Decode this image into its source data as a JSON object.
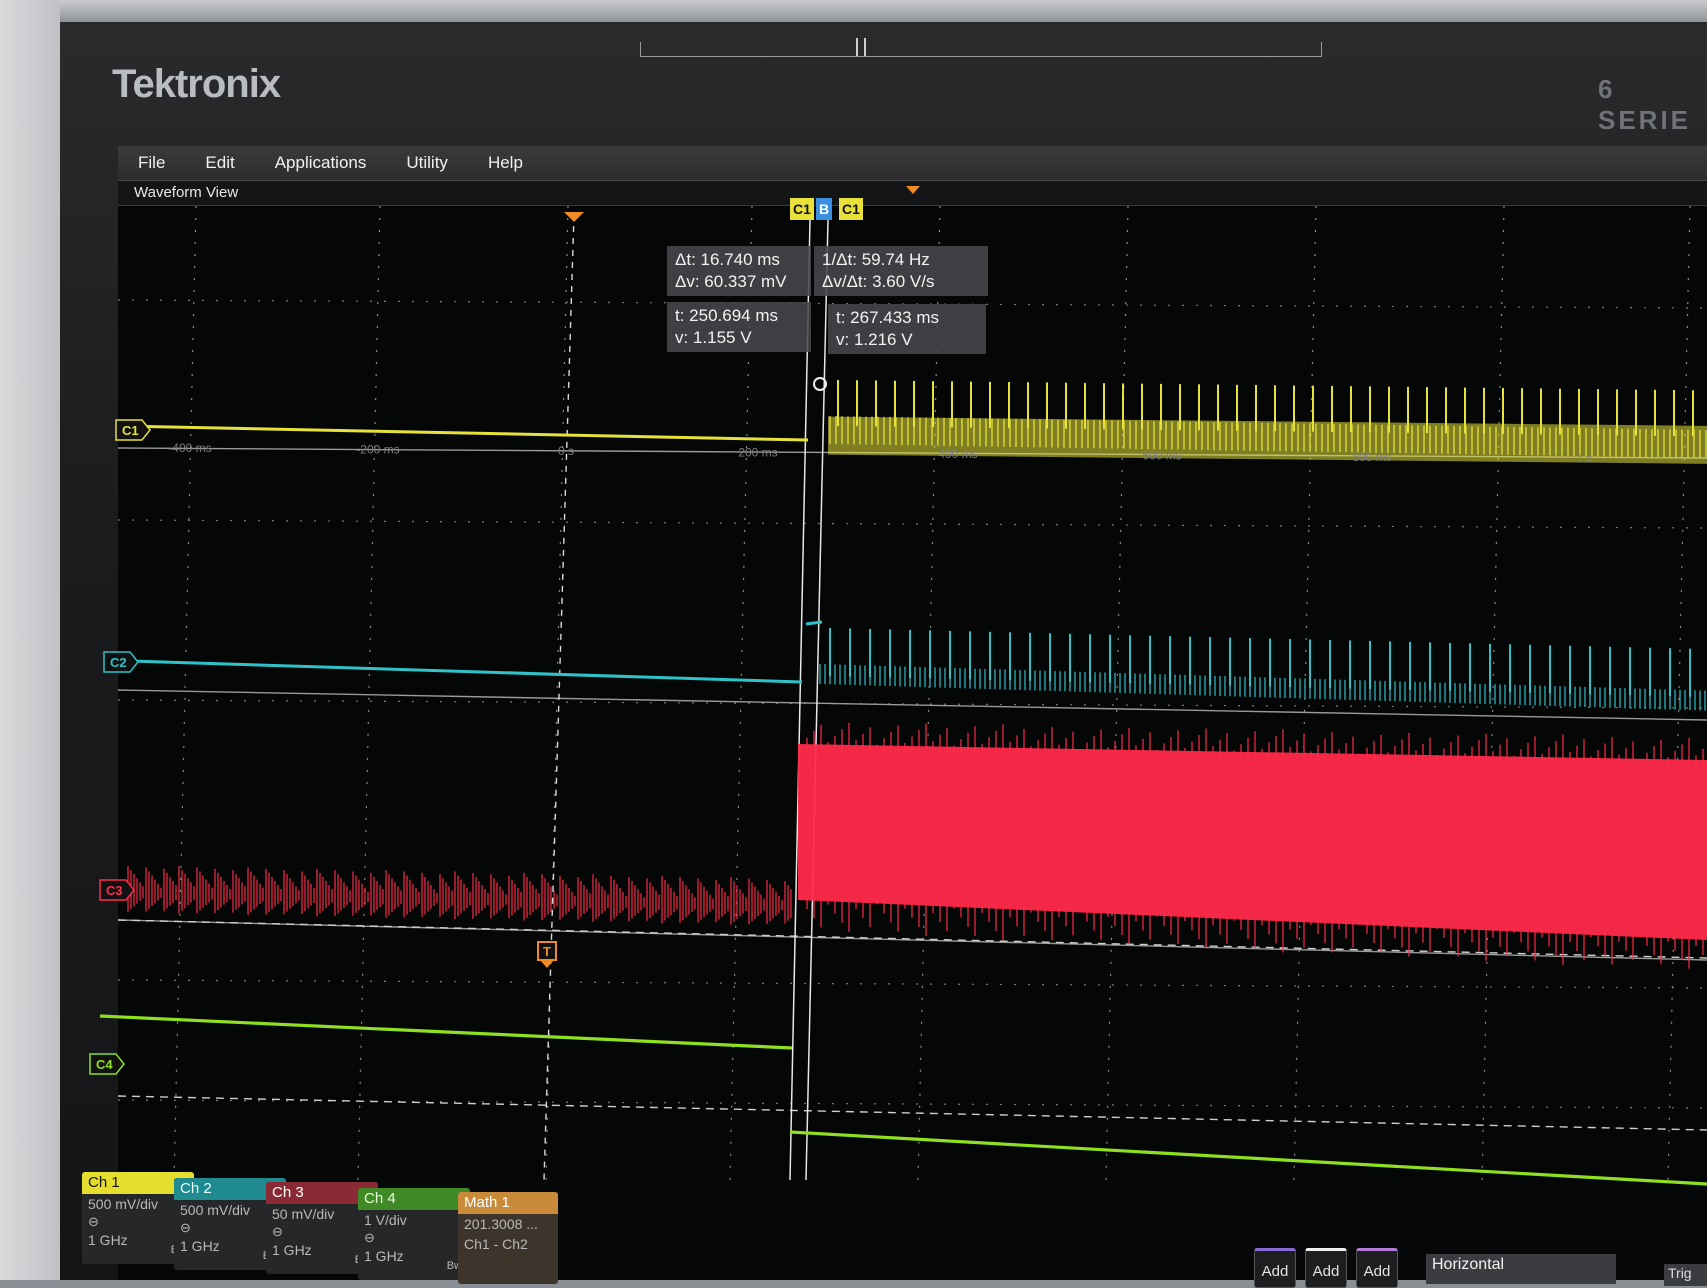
{
  "device": {
    "brand": "Tektronix",
    "model_series": "6 SERIE"
  },
  "menu": [
    "File",
    "Edit",
    "Applications",
    "Utility",
    "Help"
  ],
  "view_title": "Waveform View",
  "cursors": {
    "tag_left": "C1",
    "tag_mid": "B",
    "tag_right": "C1",
    "delta_t": "Δt: 16.740 ms",
    "delta_v": "Δv: 60.337 mV",
    "inv_delta_t": "1/Δt: 59.74 Hz",
    "dv_dt": "Δv/Δt: 3.60 V/s",
    "a_t": "t: 250.694 ms",
    "a_v": "v: 1.155 V",
    "b_t": "t: 267.433 ms",
    "b_v": "v: 1.216 V"
  },
  "time_axis_labels": [
    "-400 ms",
    "-200 ms",
    "0 s",
    "200 ms",
    "400 ms",
    "600 ms",
    "800 ms",
    "1 s"
  ],
  "channel_markers": [
    "C1",
    "C2",
    "C3",
    "C4"
  ],
  "trigger_marker": "T",
  "channels": [
    {
      "id": "ch1",
      "label": "Ch 1",
      "scale": "500 mV/div",
      "bw": "1 GHz",
      "color": "#e6e23a"
    },
    {
      "id": "ch2",
      "label": "Ch 2",
      "scale": "500 mV/div",
      "bw": "1 GHz",
      "color": "#2ec3c9"
    },
    {
      "id": "ch3",
      "label": "Ch 3",
      "scale": "50 mV/div",
      "bw": "1 GHz",
      "color": "#ff2a4a"
    },
    {
      "id": "ch4",
      "label": "Ch 4",
      "scale": "1 V/div",
      "bw": "1 GHz",
      "color": "#8fe01f"
    }
  ],
  "bw_badge": "Bw",
  "math": {
    "label": "Math 1",
    "value": "201.3008 ...",
    "expr": "Ch1 - Ch2"
  },
  "buttons": {
    "add": "Add",
    "horizontal": "Horizontal",
    "trigger": "Trig"
  }
}
